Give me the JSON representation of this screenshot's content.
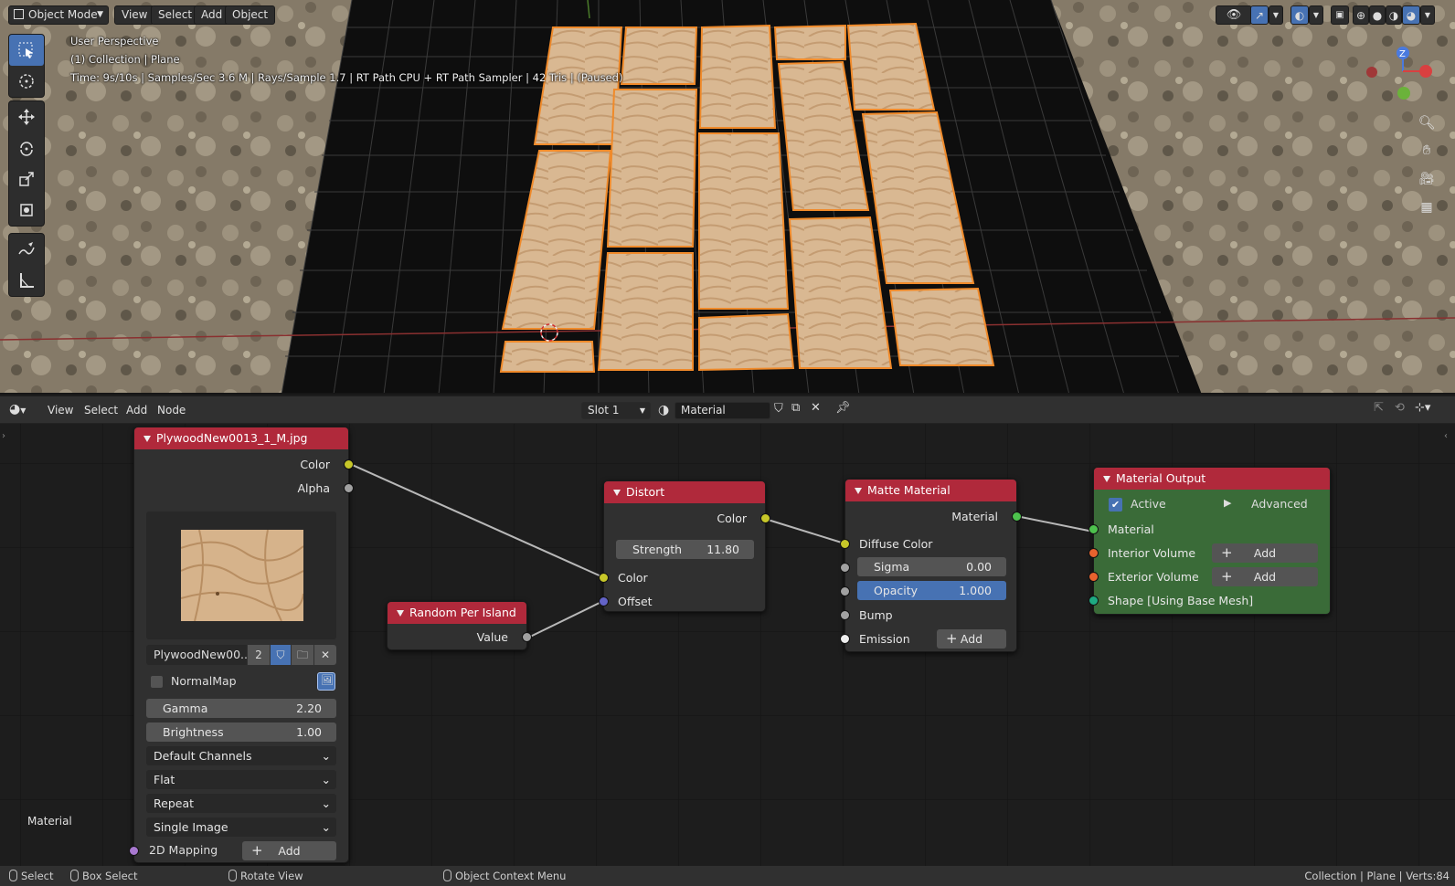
{
  "viewport": {
    "mode_label": "Object Mode",
    "menu": [
      "View",
      "Select",
      "Add",
      "Object"
    ],
    "overlay_lines": [
      "User Perspective",
      "(1) Collection | Plane",
      "Time: 9s/10s | Samples/Sec 3.6 M | Rays/Sample 1.7 | RT Path CPU + RT Path Sampler | 42 Tris | (Paused)"
    ],
    "gizmo": {
      "z": "Z"
    }
  },
  "node_editor": {
    "menu": [
      "View",
      "Select",
      "Add",
      "Node"
    ],
    "slot": "Slot 1",
    "material_name": "Material",
    "context_label": "Material",
    "image_node": {
      "title": "PlywoodNew0013_1_M.jpg",
      "outputs": [
        "Color",
        "Alpha"
      ],
      "image_name": "PlywoodNew00...",
      "users": "2",
      "normalmap_label": "NormalMap",
      "gamma_label": "Gamma",
      "gamma_value": "2.20",
      "brightness_label": "Brightness",
      "brightness_value": "1.00",
      "dropdowns": [
        "Default Channels",
        "Flat",
        "Repeat",
        "Single Image"
      ],
      "mapping_label": "2D Mapping",
      "add_label": "Add"
    },
    "random_node": {
      "title": "Random Per Island",
      "output": "Value"
    },
    "distort_node": {
      "title": "Distort",
      "output": "Color",
      "strength_label": "Strength",
      "strength_value": "11.80",
      "inputs": [
        "Color",
        "Offset"
      ]
    },
    "matte_node": {
      "title": "Matte Material",
      "output": "Material",
      "diffuse_label": "Diffuse Color",
      "sigma_label": "Sigma",
      "sigma_value": "0.00",
      "opacity_label": "Opacity",
      "opacity_value": "1.000",
      "bump_label": "Bump",
      "emission_label": "Emission",
      "add_label": "Add"
    },
    "output_node": {
      "title": "Material Output",
      "active_label": "Active",
      "advanced_label": "Advanced",
      "material_label": "Material",
      "interior_label": "Interior Volume",
      "exterior_label": "Exterior Volume",
      "shape_label": "Shape [Using Base Mesh]",
      "add_label": "Add"
    }
  },
  "status_bar": {
    "select": "Select",
    "box_select": "Box Select",
    "rotate": "Rotate View",
    "context_menu": "Object Context Menu",
    "info": "Collection | Plane | Verts:84"
  },
  "colors": {
    "accent": "#4772b3",
    "node_header": "#b0293b",
    "output_node_bg": "#3a6b38",
    "socket_color": "#c7c729",
    "socket_gray": "#a1a1a1",
    "socket_vector": "#6363c7",
    "socket_green": "#4dc24d",
    "socket_orange": "#e8632e",
    "socket_teal": "#1eaa82",
    "socket_white": "#eeeeee",
    "socket_purple": "#a878d0"
  }
}
